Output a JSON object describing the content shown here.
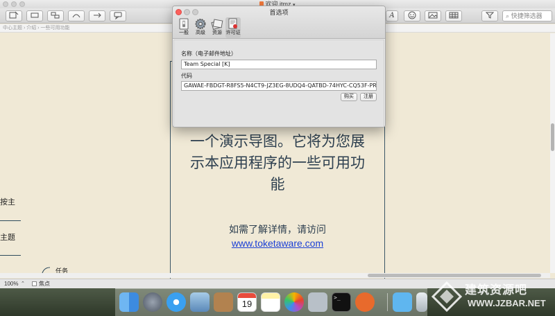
{
  "window": {
    "document_title": "欢迎.itmz",
    "search_placeholder": "快捷筛选器",
    "breadcrumb": "中心主题 › 介绍 › 一些可用功能"
  },
  "canvas": {
    "left_nodes": [
      "按主",
      "主题"
    ],
    "small_node": "任务",
    "central_lines": [
      "一个演示导图。它将为您展",
      "示本应用程序的一些可用功",
      "能"
    ],
    "info_text": "如需了解详情，请访问",
    "link_text": "www.toketaware.com"
  },
  "statusbar": {
    "zoom": "100%",
    "focus_label": "焦点"
  },
  "dialog": {
    "title": "首选项",
    "tabs": [
      {
        "label": "一般",
        "icon": "switch-icon"
      },
      {
        "label": "高级",
        "icon": "gear-icon"
      },
      {
        "label": "资源",
        "icon": "resources-icon"
      },
      {
        "label": "许可证",
        "icon": "license-icon"
      }
    ],
    "active_tab": "许可证",
    "name_label": "名称（电子邮件地址）",
    "name_value": "Team Special [K]",
    "code_label": "代码",
    "code_value": "GAWAE-FBDGT-R8FS5-N4CT9-JZ3EG-8UDQ4-QATBD-74HYC-CQ53F-PR",
    "buy_label": "购买",
    "register_label": "注册"
  },
  "dock": {
    "items": [
      "finder-icon",
      "launchpad-icon",
      "safari-icon",
      "mail-icon",
      "contacts-icon",
      "calendar-icon",
      "notes-icon",
      "photos-icon",
      "utility-icon",
      "terminal-icon",
      "app-icon",
      "downloads-icon",
      "trash-icon"
    ],
    "calendar_day": "19"
  },
  "watermark": {
    "title": "建筑资源吧",
    "url": "WWW.JZBAR.NET"
  },
  "colors": {
    "canvas_bg": "#f0e9d6",
    "node_text": "#2e4050",
    "link": "#1a3fd6",
    "close": "#fc605c"
  }
}
